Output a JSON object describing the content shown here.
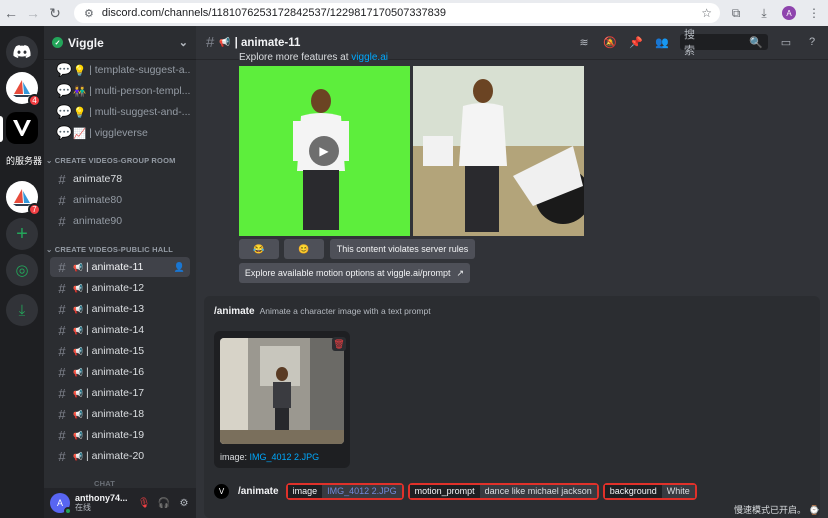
{
  "browser": {
    "url": "discord.com/channels/1181076253172842537/1229817170507337839",
    "profile_initial": "A"
  },
  "rails": {
    "badge1": "4",
    "badge2": "7",
    "label_partial": "的服务器"
  },
  "guild": {
    "name": "Viggle"
  },
  "channels_top": [
    {
      "icon": "💡",
      "label": "| template-suggest-a..."
    },
    {
      "icon": "👫",
      "label": "| multi-person-templ..."
    },
    {
      "icon": "💡",
      "label": "| multi-suggest-and-..."
    },
    {
      "icon": "📈",
      "label": "| viggleverse"
    }
  ],
  "category_group_room": "CREATE VIDEOS-GROUP ROOM",
  "group_room_channels": [
    "animate78",
    "animate80",
    "animate90"
  ],
  "category_public_hall": "CREATE VIDEOS-PUBLIC HALL",
  "public_hall_channels": [
    "| animate-11",
    "| animate-12",
    "| animate-13",
    "| animate-14",
    "| animate-15",
    "| animate-16",
    "| animate-17",
    "| animate-18",
    "| animate-19",
    "| animate-20"
  ],
  "category_chat": "CHAT",
  "user": {
    "name": "anthony74...",
    "status": "在线",
    "avatar_initial": "A"
  },
  "topbar": {
    "channel": "| animate-11",
    "search_placeholder": "搜索"
  },
  "message": {
    "explore_text": "Explore more features at",
    "explore_link": "viggle.ai",
    "reaction1": "😂",
    "reaction2": "😊",
    "violation": "This content violates server rules",
    "motion_link": "Explore available motion options at viggle.ai/prompt"
  },
  "command": {
    "name": "/animate",
    "description": "Animate a character image with a text prompt",
    "file_label": "image:",
    "file_name": "IMG_4012 2.JPG",
    "options": [
      {
        "key": "image",
        "value": "IMG_4012 2.JPG"
      },
      {
        "key": "motion_prompt",
        "value": "dance like michael jackson"
      },
      {
        "key": "background",
        "value": "White"
      }
    ]
  },
  "toast": "慢速模式已开启。"
}
